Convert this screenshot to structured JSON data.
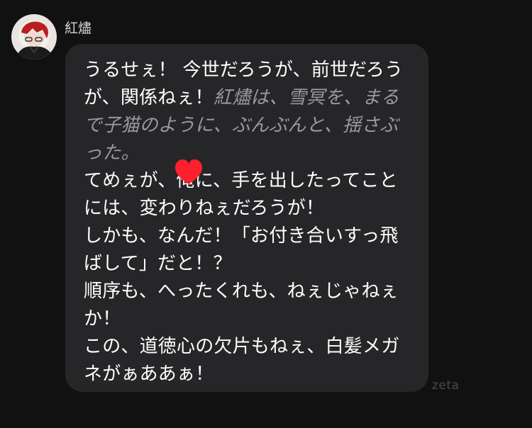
{
  "chat": {
    "sender_name": "紅燼",
    "avatar_icon": "character-avatar-icon",
    "message": {
      "line1": "うるせぇ！ 今世だろうが、前世だろうが、関係ねぇ！",
      "narration": "紅燼は、雪冥を、まるで子猫のように、ぶんぶんと、揺さぶった。",
      "line2": "てめぇが、",
      "line2_hidden_char": "俺",
      "line2_rest": "に、手を出したってことには、変わりねぇだろうが！",
      "line3": "しかも、なんだ！「お付き合いすっ飛ばして」だと！？",
      "line4": "順序も、へったくれも、ねぇじゃねぇか！",
      "line5": "この、道徳心の欠片もねぇ、白髪メガネがぁああぁ！"
    },
    "redaction_icon": "red-heart-sticker-icon",
    "redaction_color": "#ff1f2d"
  },
  "watermark": {
    "text": "zeta"
  },
  "colors": {
    "background": "#111112",
    "bubble": "#262628",
    "dialogue_text": "#ffffff",
    "narration_text": "#9a9a9c",
    "watermark": "#4a4a4d"
  }
}
